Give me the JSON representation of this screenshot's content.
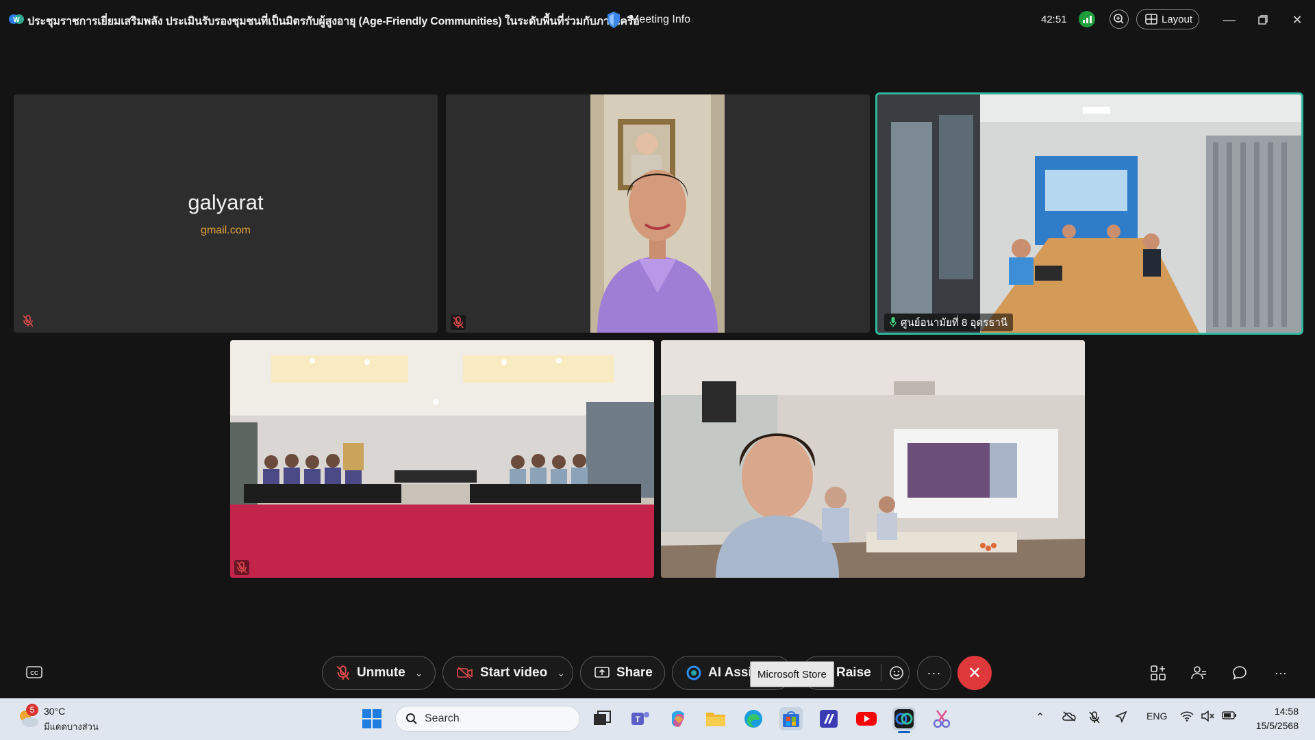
{
  "titlebar": {
    "meeting_title": "ประชุมราชการเยี่ยมเสริมพลัง ประเมินรับรองชุมชนที่เป็นมิตรกับผู้สูงอายุ (Age-Friendly Communities) ในระดับพื้นที่ร่วมกับภาคีเครือ",
    "meeting_info": "Meeting Info",
    "timer": "42:51",
    "layout_label": "Layout",
    "signal_color": "#1f9d3a"
  },
  "tiles": {
    "tile1": {
      "name": "galyarat",
      "email": "gmail.com",
      "muted": true
    },
    "tile2": {
      "muted": true
    },
    "tile3": {
      "label": "ศูนย์อนามัยที่ 8 อุดรธานี",
      "active_speaker": true,
      "border_color": "#2fb7a0"
    },
    "tile4": {
      "muted": true
    },
    "tile5": {
      "muted": false
    }
  },
  "controls": {
    "unmute": "Unmute",
    "start_video": "Start video",
    "share": "Share",
    "ai_assistant": "AI Assi",
    "raise": "Raise",
    "more": "···",
    "tooltip": "Microsoft Store",
    "end_color": "#e0393b"
  },
  "taskbar": {
    "weather_badge": "5",
    "temperature": "30°C",
    "weather_desc": "มีแดดบางส่วน",
    "search_placeholder": "Search",
    "language": "ENG",
    "time": "14:58",
    "date": "15/5/2568"
  }
}
